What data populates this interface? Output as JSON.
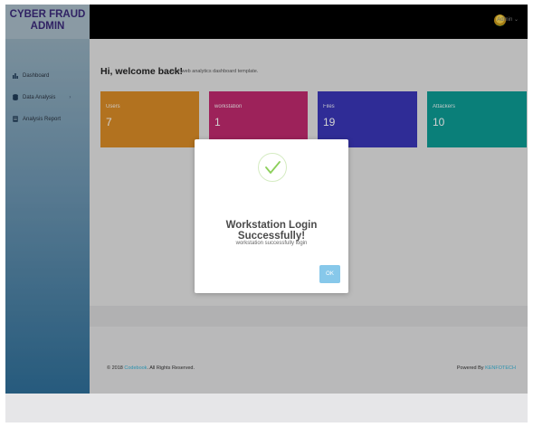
{
  "sidebar": {
    "brand_line1": "CYBER FRAUD",
    "brand_line2": "ADMIN",
    "items": [
      {
        "label": "Dashboard",
        "icon": "chart-icon"
      },
      {
        "label": "Data Analysis",
        "icon": "database-icon"
      },
      {
        "label": "Analysis Report",
        "icon": "report-icon"
      }
    ]
  },
  "topbar": {
    "user": "Admin",
    "caret": "⌄"
  },
  "main": {
    "welcome": "Hi, welcome back!",
    "welcome_sub": "Your web analytics dashboard template.",
    "cards": [
      {
        "label": "Users",
        "value": "7",
        "color": "#d98b26"
      },
      {
        "label": "workstation",
        "value": "1",
        "color": "#c02a6e"
      },
      {
        "label": "Files",
        "value": "19",
        "color": "#3a36b8"
      },
      {
        "label": "Attackers",
        "value": "10",
        "color": "#0d9c94"
      }
    ]
  },
  "footer": {
    "copyright_prefix": "© 2018",
    "copyright_link": "Codebook",
    "copyright_suffix": ". All Rights Reserved.",
    "powered_prefix": "Powered By",
    "powered_link": "KENFOTECH"
  },
  "modal": {
    "title": "Workstation Login Successfully!",
    "message": "workstation successfully login",
    "ok_label": "OK",
    "check_color": "#8ccf5a"
  }
}
